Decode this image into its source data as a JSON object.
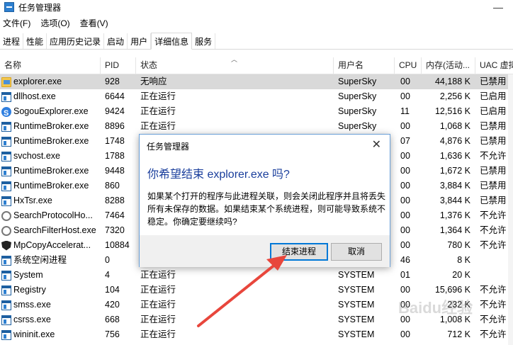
{
  "window": {
    "title": "任务管理器",
    "minimize": "—"
  },
  "menu": [
    "文件(F)",
    "选项(O)",
    "查看(V)"
  ],
  "tabs": [
    "进程",
    "性能",
    "应用历史记录",
    "启动",
    "用户",
    "详细信息",
    "服务"
  ],
  "columns": {
    "name": "名称",
    "pid": "PID",
    "status": "状态",
    "user": "用户名",
    "cpu": "CPU",
    "memory": "内存(活动...",
    "uac": "UAC 虚拟"
  },
  "rows": [
    {
      "icon": "folder",
      "name": "explorer.exe",
      "pid": "928",
      "status": "无响应",
      "user": "SuperSky",
      "cpu": "00",
      "mem": "44,188 K",
      "uac": "已禁用"
    },
    {
      "icon": "window",
      "name": "dllhost.exe",
      "pid": "6644",
      "status": "正在运行",
      "user": "SuperSky",
      "cpu": "00",
      "mem": "2,256 K",
      "uac": "已启用"
    },
    {
      "icon": "sogou",
      "name": "SogouExplorer.exe",
      "pid": "9424",
      "status": "正在运行",
      "user": "SuperSky",
      "cpu": "11",
      "mem": "12,516 K",
      "uac": "已启用"
    },
    {
      "icon": "window",
      "name": "RuntimeBroker.exe",
      "pid": "8896",
      "status": "正在运行",
      "user": "SuperSky",
      "cpu": "00",
      "mem": "1,068 K",
      "uac": "已禁用"
    },
    {
      "icon": "window",
      "name": "RuntimeBroker.exe",
      "pid": "1748",
      "status": "",
      "user": "",
      "cpu": "07",
      "mem": "4,876 K",
      "uac": "已禁用"
    },
    {
      "icon": "window",
      "name": "svchost.exe",
      "pid": "1788",
      "status": "",
      "user": "",
      "cpu": "00",
      "mem": "1,636 K",
      "uac": "不允许"
    },
    {
      "icon": "window",
      "name": "RuntimeBroker.exe",
      "pid": "9448",
      "status": "",
      "user": "",
      "cpu": "00",
      "mem": "1,672 K",
      "uac": "已禁用"
    },
    {
      "icon": "window",
      "name": "RuntimeBroker.exe",
      "pid": "860",
      "status": "",
      "user": "",
      "cpu": "00",
      "mem": "3,884 K",
      "uac": "已禁用"
    },
    {
      "icon": "window",
      "name": "HxTsr.exe",
      "pid": "8288",
      "status": "",
      "user": "",
      "cpu": "00",
      "mem": "3,844 K",
      "uac": "已禁用"
    },
    {
      "icon": "search",
      "name": "SearchProtocolHo...",
      "pid": "7464",
      "status": "",
      "user": "",
      "cpu": "00",
      "mem": "1,376 K",
      "uac": "不允许"
    },
    {
      "icon": "search",
      "name": "SearchFilterHost.exe",
      "pid": "7320",
      "status": "",
      "user": "",
      "cpu": "00",
      "mem": "1,364 K",
      "uac": "不允许"
    },
    {
      "icon": "shield",
      "name": "MpCopyAccelerat...",
      "pid": "10884",
      "status": "",
      "user": "",
      "cpu": "00",
      "mem": "780 K",
      "uac": "不允许"
    },
    {
      "icon": "window",
      "name": "系统空闲进程",
      "pid": "0",
      "status": "",
      "user": "",
      "cpu": "46",
      "mem": "8 K",
      "uac": ""
    },
    {
      "icon": "window",
      "name": "System",
      "pid": "4",
      "status": "正在运行",
      "user": "SYSTEM",
      "cpu": "01",
      "mem": "20 K",
      "uac": ""
    },
    {
      "icon": "window",
      "name": "Registry",
      "pid": "104",
      "status": "正在运行",
      "user": "SYSTEM",
      "cpu": "00",
      "mem": "15,696 K",
      "uac": "不允许"
    },
    {
      "icon": "window",
      "name": "smss.exe",
      "pid": "420",
      "status": "正在运行",
      "user": "SYSTEM",
      "cpu": "00",
      "mem": "232 K",
      "uac": "不允许"
    },
    {
      "icon": "window",
      "name": "csrss.exe",
      "pid": "668",
      "status": "正在运行",
      "user": "SYSTEM",
      "cpu": "00",
      "mem": "1,008 K",
      "uac": "不允许"
    },
    {
      "icon": "window",
      "name": "wininit.exe",
      "pid": "756",
      "status": "正在运行",
      "user": "SYSTEM",
      "cpu": "00",
      "mem": "712 K",
      "uac": "不允许"
    }
  ],
  "dialog": {
    "title": "任务管理器",
    "close": "✕",
    "question": "你希望结束 explorer.exe 吗?",
    "message": "如果某个打开的程序与此进程关联，则会关闭此程序并且将丢失所有未保存的数据。如果结束某个系统进程，则可能导致系统不稳定。你确定要继续吗?",
    "end_button": "结束进程",
    "cancel_button": "取消"
  },
  "accent_color": "#0078d7",
  "arrow_color": "#e8463c",
  "watermark": "Baidu经验"
}
